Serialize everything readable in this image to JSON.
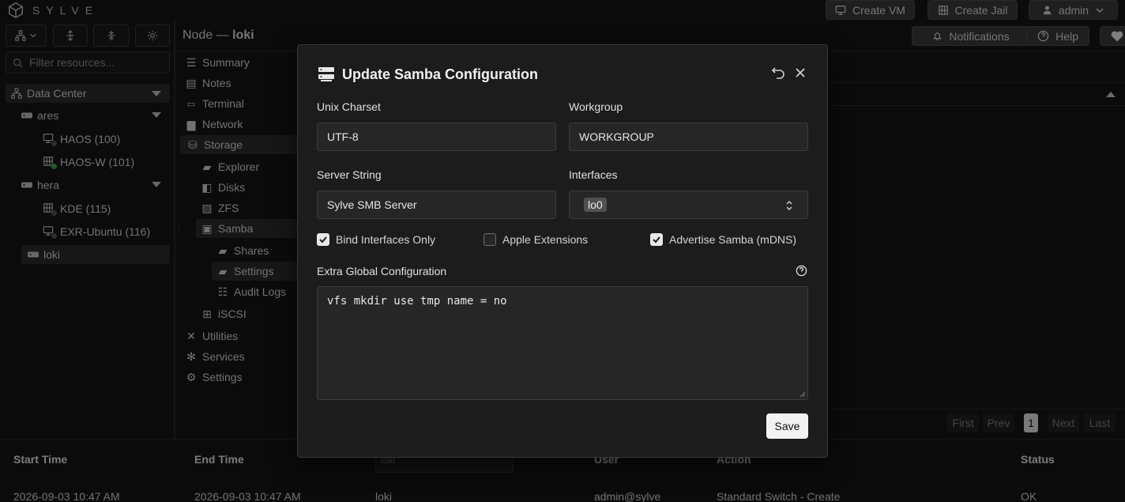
{
  "app": {
    "logo_text": "SYLVE"
  },
  "topbar": {
    "create_vm": "Create VM",
    "create_jail": "Create Jail",
    "user": "admin"
  },
  "header": {
    "node_prefix": "Node —",
    "node_name": "loki",
    "notifications": "Notifications",
    "help": "Help"
  },
  "sidebar": {
    "filter_placeholder": "Filter resources...",
    "datacenter": "Data Center",
    "nodes": [
      {
        "name": "ares",
        "items": [
          "HAOS (100)",
          "HAOS-W (101)"
        ]
      },
      {
        "name": "hera",
        "items": [
          "KDE (115)",
          "EXR-Ubuntu (116)"
        ]
      }
    ],
    "selected_node": "loki"
  },
  "nav": {
    "summary": "Summary",
    "notes": "Notes",
    "terminal": "Terminal",
    "network": "Network",
    "storage": "Storage",
    "explorer": "Explorer",
    "disks": "Disks",
    "zfs": "ZFS",
    "samba": "Samba",
    "shares": "Shares",
    "settings_sub": "Settings",
    "audit_logs": "Audit Logs",
    "iscsi": "iSCSI",
    "utilities": "Utilities",
    "services": "Services",
    "settings": "Settings"
  },
  "modal": {
    "title": "Update Samba Configuration",
    "unix_charset_label": "Unix Charset",
    "unix_charset_value": "UTF-8",
    "workgroup_label": "Workgroup",
    "workgroup_value": "WORKGROUP",
    "server_string_label": "Server String",
    "server_string_value": "Sylve SMB Server",
    "interfaces_label": "Interfaces",
    "interfaces_value": "lo0",
    "bind_only_label": "Bind Interfaces Only",
    "bind_only_checked": true,
    "apple_ext_label": "Apple Extensions",
    "apple_ext_checked": false,
    "advertise_label": "Advertise Samba (mDNS)",
    "advertise_checked": true,
    "extra_label": "Extra Global Configuration",
    "extra_value": "vfs mkdir use tmp name = no",
    "save": "Save"
  },
  "pagination": {
    "first": "First",
    "prev": "Prev",
    "page": "1",
    "next": "Next",
    "last": "Last"
  },
  "table": {
    "headers": {
      "start": "Start Time",
      "end": "End Time",
      "user": "User",
      "action": "Action",
      "status": "Status"
    },
    "node_filter": "loki",
    "row": {
      "start": "2026-09-03 10:47 AM",
      "end": "2026-09-03 10:47 AM",
      "node": "loki",
      "user": "admin@sylve",
      "action": "Standard Switch - Create",
      "status": "OK"
    }
  },
  "colors": {
    "accent_green": "#2faa4a",
    "modal_bg": "#1c1c1c",
    "save_bg": "#f2f2f2"
  }
}
